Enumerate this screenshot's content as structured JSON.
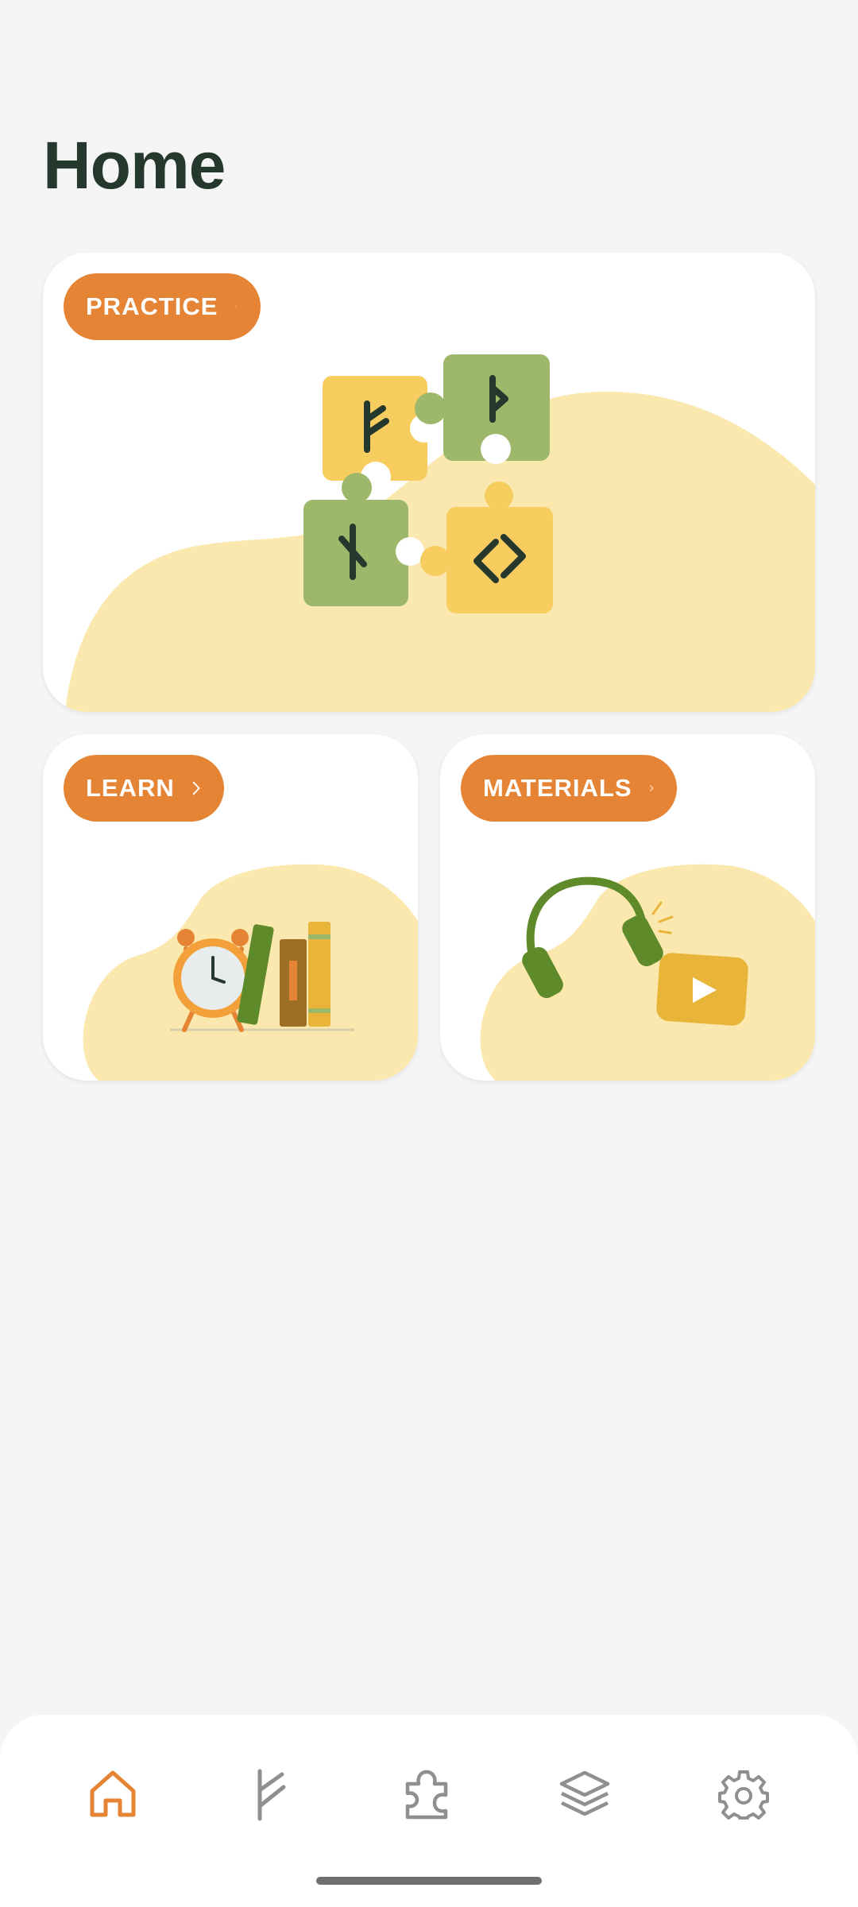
{
  "page": {
    "title": "Home"
  },
  "cards": {
    "practice": {
      "label": "PRACTICE"
    },
    "learn": {
      "label": "LEARN"
    },
    "materials": {
      "label": "MATERIALS"
    }
  },
  "colors": {
    "accent": "#e58435",
    "blob": "#fae8ae",
    "puzzle_yellow": "#f6cd5e",
    "puzzle_green": "#9db86a",
    "title": "#24382e"
  },
  "nav": {
    "items": [
      {
        "icon": "home-icon",
        "active": true
      },
      {
        "icon": "rune-icon",
        "active": false
      },
      {
        "icon": "puzzle-icon",
        "active": false
      },
      {
        "icon": "layers-icon",
        "active": false
      },
      {
        "icon": "gear-icon",
        "active": false
      }
    ]
  }
}
